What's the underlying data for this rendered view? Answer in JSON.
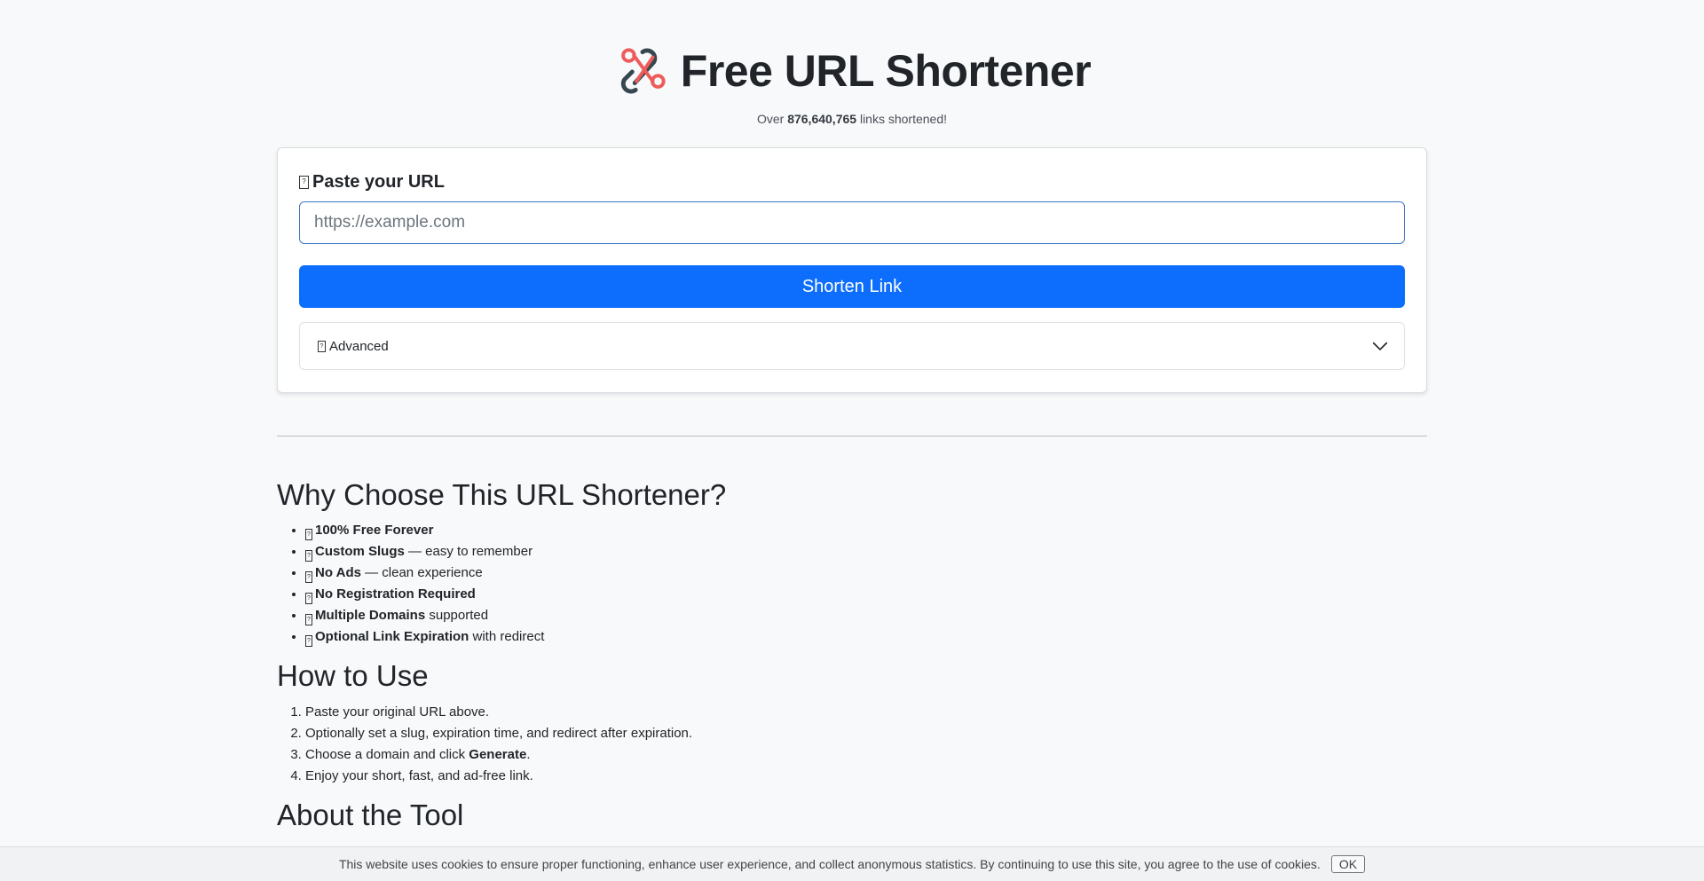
{
  "header": {
    "title": "Free URL Shortener",
    "counter_prefix": "Over",
    "counter_value": "876,640,765",
    "counter_suffix": "links shortened!"
  },
  "form": {
    "label": "Paste your URL",
    "input_placeholder": "https://example.com",
    "input_value": "",
    "submit_label": "Shorten Link",
    "advanced_label": "Advanced"
  },
  "why": {
    "heading": "Why Choose This URL Shortener?",
    "items": [
      {
        "bold": "100% Free Forever",
        "rest": ""
      },
      {
        "bold": "Custom Slugs",
        "rest": " — easy to remember"
      },
      {
        "bold": "No Ads",
        "rest": " — clean experience"
      },
      {
        "bold": "No Registration Required",
        "rest": ""
      },
      {
        "bold": "Multiple Domains",
        "rest": " supported"
      },
      {
        "bold": "Optional Link Expiration",
        "rest": " with redirect"
      }
    ]
  },
  "how": {
    "heading": "How to Use",
    "steps": [
      "Paste your original URL above.",
      "Optionally set a slug, expiration time, and redirect after expiration.",
      {
        "pre": "Choose a domain and click ",
        "bold": "Generate",
        "post": "."
      },
      "Enjoy your short, fast, and ad-free link."
    ]
  },
  "about": {
    "heading": "About the Tool"
  },
  "cookie": {
    "text": "This website uses cookies to ensure proper functioning, enhance user experience, and collect anonymous statistics. By continuing to use this site, you agree to the use of cookies.",
    "ok_label": "OK"
  },
  "icons": {
    "logo": "scissors-link-icon",
    "missing_glyph": "missing-glyph-icon",
    "advanced_toggle": "chevron-down-icon"
  },
  "colors": {
    "primary": "#0d6efd",
    "logo_red": "#ee5b5b",
    "logo_dark": "#37474f"
  }
}
